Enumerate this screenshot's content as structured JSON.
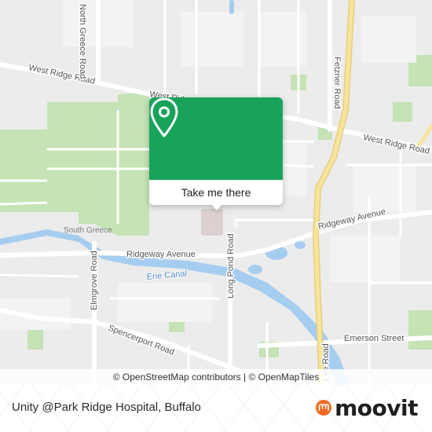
{
  "map": {
    "roads": {
      "west_ridge_road_1": "West Ridge Road",
      "west_ridge_road_2": "West Ridge Road",
      "west_ridge_road_3": "West Ridge Road",
      "north_greece_road": "North Greece Road",
      "fetzner_road": "Fetzner Road",
      "ridgeway_avenue_1": "Ridgeway Avenue",
      "ridgeway_avenue_2": "Ridgeway Avenue",
      "elmgrove_road": "Elmgrove Road",
      "long_pond_road": "Long Pond Road",
      "spencerport_road": "Spencerport Road",
      "lee_road": "Lee Road",
      "emerson_street": "Emerson Street"
    },
    "areas": {
      "south_greece": "South Greece"
    },
    "water": {
      "erie_canal": "Erie Canal"
    },
    "colors": {
      "background": "#ececec",
      "park": "#c5e3b5",
      "water": "#a5cdf0",
      "highway": "#f7e59d",
      "road": "#ffffff"
    }
  },
  "popup": {
    "action_label": "Take me there",
    "icon": "location-pin-icon",
    "color": "#19a35a"
  },
  "attribution": {
    "osm": "© OpenStreetMap contributors",
    "separator": " | ",
    "omt": "© OpenMapTiles"
  },
  "footer": {
    "place_name": "Unity @Park Ridge Hospital, Buffalo",
    "brand": "moovit",
    "brand_color": "#f26a21"
  }
}
